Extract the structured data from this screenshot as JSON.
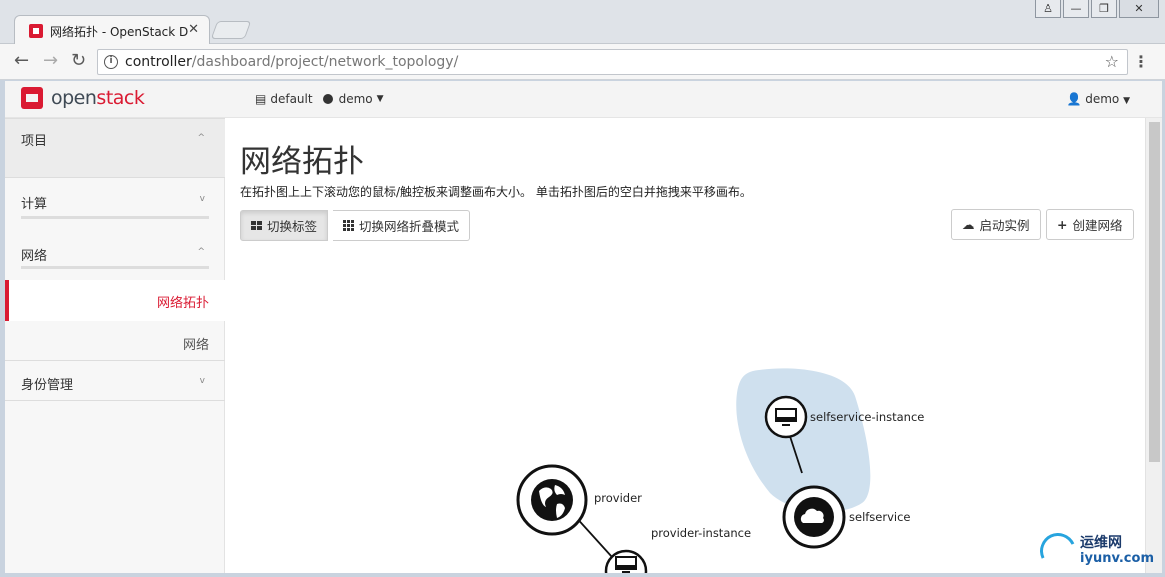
{
  "browser": {
    "tab_title": "网络拓扑 - OpenStack D",
    "url_host": "controller",
    "url_path": "/dashboard/project/network_topology/",
    "window_buttons": [
      "♙",
      "—",
      "❐",
      "✕"
    ]
  },
  "header": {
    "logo_prefix": "open",
    "logo_suffix": "stack",
    "domain": "default",
    "project": "demo",
    "user": "demo"
  },
  "sidebar": {
    "sections": [
      {
        "label": "项目",
        "chevron": "^"
      },
      {
        "label": "计算",
        "chevron": "v"
      },
      {
        "label": "网络",
        "chevron": "^"
      }
    ],
    "active_item": "网络拓扑",
    "item_network": "网络",
    "identity": {
      "label": "身份管理",
      "chevron": "v"
    }
  },
  "main": {
    "title": "网络拓扑",
    "description": "在拓扑图上上下滚动您的鼠标/触控板来调整画布大小。 单击拓扑图后的空白并拖拽来平移画布。",
    "toggle_labels_btn": "切换标签",
    "toggle_collapse_btn": "切换网络折叠模式",
    "launch_instance_btn": "启动实例",
    "create_network_btn": "创建网络"
  },
  "topology": {
    "nodes": {
      "provider": "provider",
      "provider_instance": "provider-instance",
      "selfservice": "selfservice",
      "selfservice_instance": "selfservice-instance"
    },
    "network_group_color": "#cfe0ee"
  },
  "watermark": {
    "cn": "运维网",
    "en": "iyunv.com"
  },
  "colors": {
    "accent": "#da1a32"
  }
}
